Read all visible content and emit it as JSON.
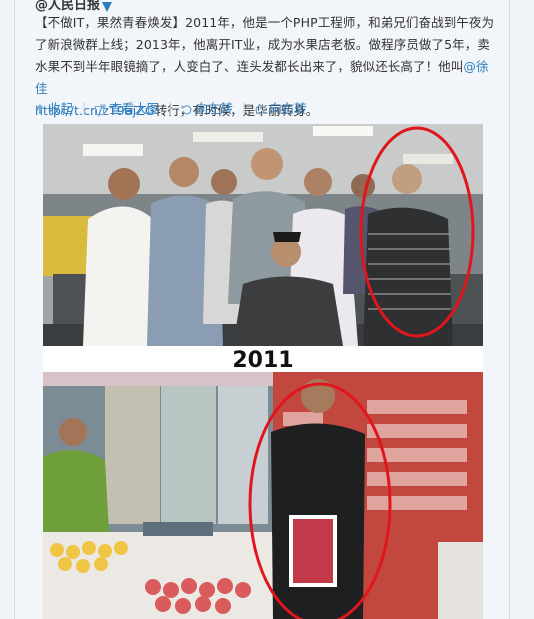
{
  "post": {
    "author": "@人民日报",
    "text_part1": "【不做IT，果然青春焕发】2011年，他是一个PHP工程师，和弟兄们奋战到午夜为了新浪微群上线；2013年，他离开IT业，成为水果店老板。做程序员做了5年，卖水果不到半年眼镜摘了，人变白了、连头发都长出来了，貌似还长高了！他叫",
    "mention": "@徐佳",
    "link": "http://t.cn/zT9ajZG",
    "text_part2": "转行，有时候，是华丽转身。"
  },
  "actions": {
    "collapse": "收起",
    "view_large": "查看大图",
    "rotate_left": "向左转",
    "rotate_right": "向右转",
    "separator": "|"
  },
  "photo": {
    "year_label": "2011"
  },
  "colors": {
    "link": "#2b7cbf",
    "highlight_circle": "#e0161c",
    "card_bg": "#f2f6fa"
  },
  "icons": {
    "collapse": "arrow-up-icon",
    "view_large": "external-link-icon",
    "rotate_left": "rotate-left-icon",
    "rotate_right": "rotate-right-icon",
    "verified": "verified-badge-icon"
  }
}
